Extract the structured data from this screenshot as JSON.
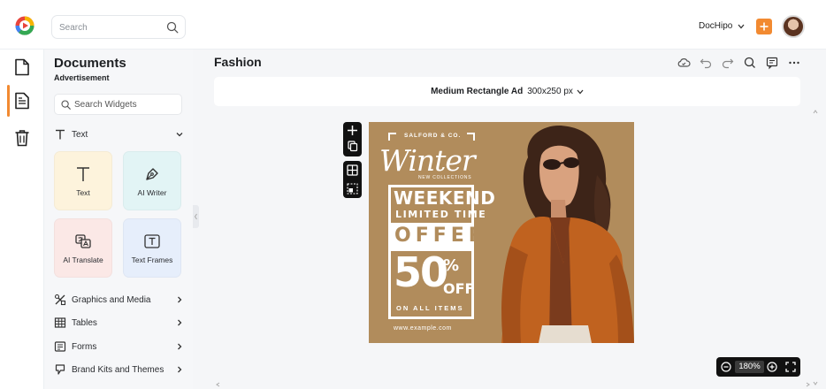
{
  "header": {
    "search_placeholder": "Search",
    "account_label": "DocHipo"
  },
  "sidebar": {
    "items": [
      {
        "icon": "document-icon"
      },
      {
        "icon": "document-lines-icon",
        "active": true
      },
      {
        "icon": "trash-icon"
      }
    ]
  },
  "panel": {
    "title": "Documents",
    "subtitle": "Advertisement",
    "search_placeholder": "Search Widgets",
    "text_section": "Text",
    "cards": [
      "Text",
      "AI Writer",
      "AI Translate",
      "Text Frames"
    ],
    "sections": [
      "Graphics and Media",
      "Tables",
      "Forms",
      "Brand Kits and Themes"
    ]
  },
  "main": {
    "doc_title": "Fashion",
    "size_name": "Medium Rectangle Ad",
    "size_dims": "300x250 px",
    "zoom": "180%"
  },
  "ad": {
    "brand": "SALFORD & CO.",
    "headline": "Winter",
    "subline": "NEW COLLECTIONS",
    "weekend": "WEEKEND",
    "limited": "LIMITED TIME",
    "offer": "OFFER",
    "discount": "50",
    "percent": "%",
    "off": "OFF",
    "on_all": "ON ALL ITEMS",
    "url": "www.example.com"
  },
  "colors": {
    "accent": "#f28a31",
    "ad_background": "#b18c5c"
  }
}
